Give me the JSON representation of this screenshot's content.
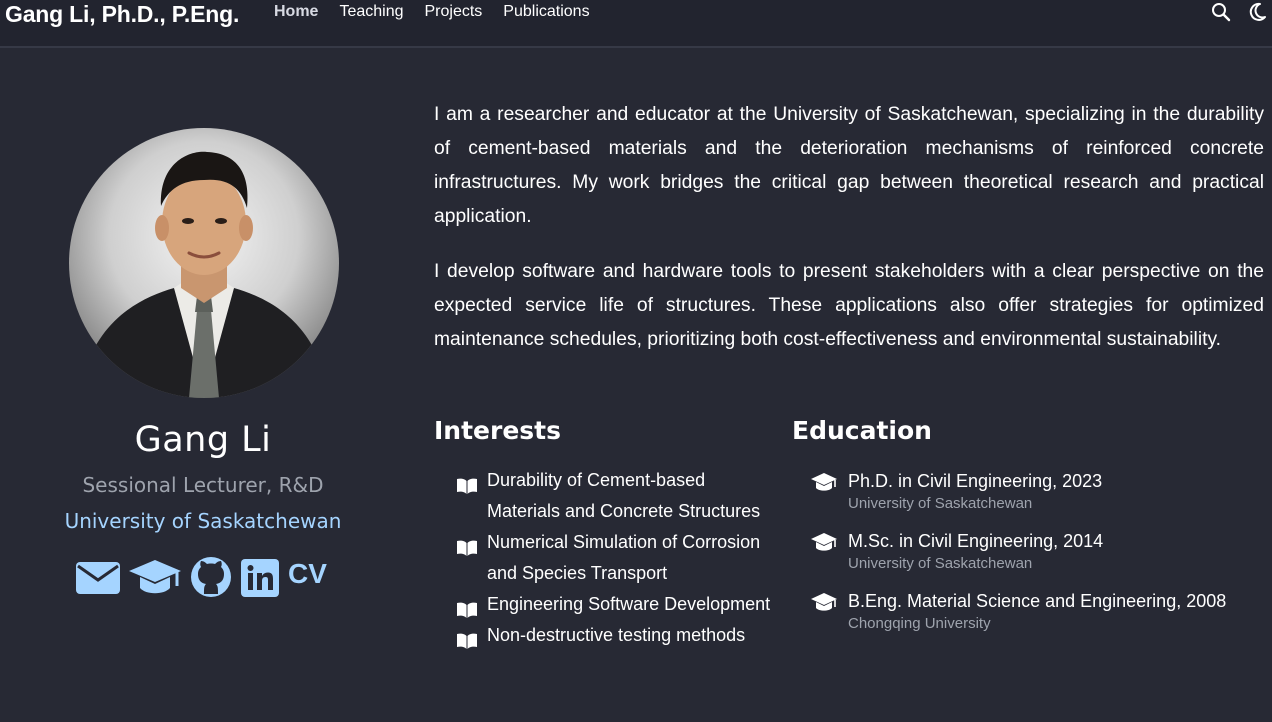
{
  "navbar": {
    "brand": "Gang Li, Ph.D., P.Eng.",
    "links": [
      "Home",
      "Teaching",
      "Projects",
      "Publications"
    ],
    "active": "Home",
    "icons": [
      "search-icon",
      "moon-icon"
    ]
  },
  "profile": {
    "name": "Gang Li",
    "role": "Sessional Lecturer, R&D",
    "organization": "University of Saskatchewan",
    "socials": [
      "envelope-icon",
      "graduation-cap-icon",
      "github-icon",
      "linkedin-icon"
    ],
    "cv_label": "CV"
  },
  "bio": {
    "paragraph_1": "I am a researcher and educator at the University of Saskatchewan, specializing in the durability of cement-based materials and the deterioration mechanisms of reinforced concrete infrastructures. My work bridges the critical gap between theoretical research and practical application.",
    "paragraph_2": "I develop software and hardware tools to present stakeholders with a clear perspective on the expected service life of structures. These applications also offer strategies for optimized maintenance schedules, prioritizing both cost-effectiveness and environmental sustainability."
  },
  "interests": {
    "title": "Interests",
    "items": [
      "Durability of Cement-based Materials and Concrete Structures",
      "Numerical Simulation of Corrosion and Species Transport",
      "Engineering Software Development",
      "Non-destructive testing methods"
    ]
  },
  "education": {
    "title": "Education",
    "items": [
      {
        "degree": "Ph.D. in Civil Engineering, 2023",
        "school": "University of Saskatchewan"
      },
      {
        "degree": "M.Sc. in Civil Engineering, 2014",
        "school": "University of Saskatchewan"
      },
      {
        "degree": "B.Eng. Material Science and Engineering, 2008",
        "school": "Chongqing University"
      }
    ]
  },
  "colors": {
    "background": "#272934",
    "navbar": "#22242f",
    "accent": "#a5d4ff",
    "muted": "#9ea3ad"
  }
}
